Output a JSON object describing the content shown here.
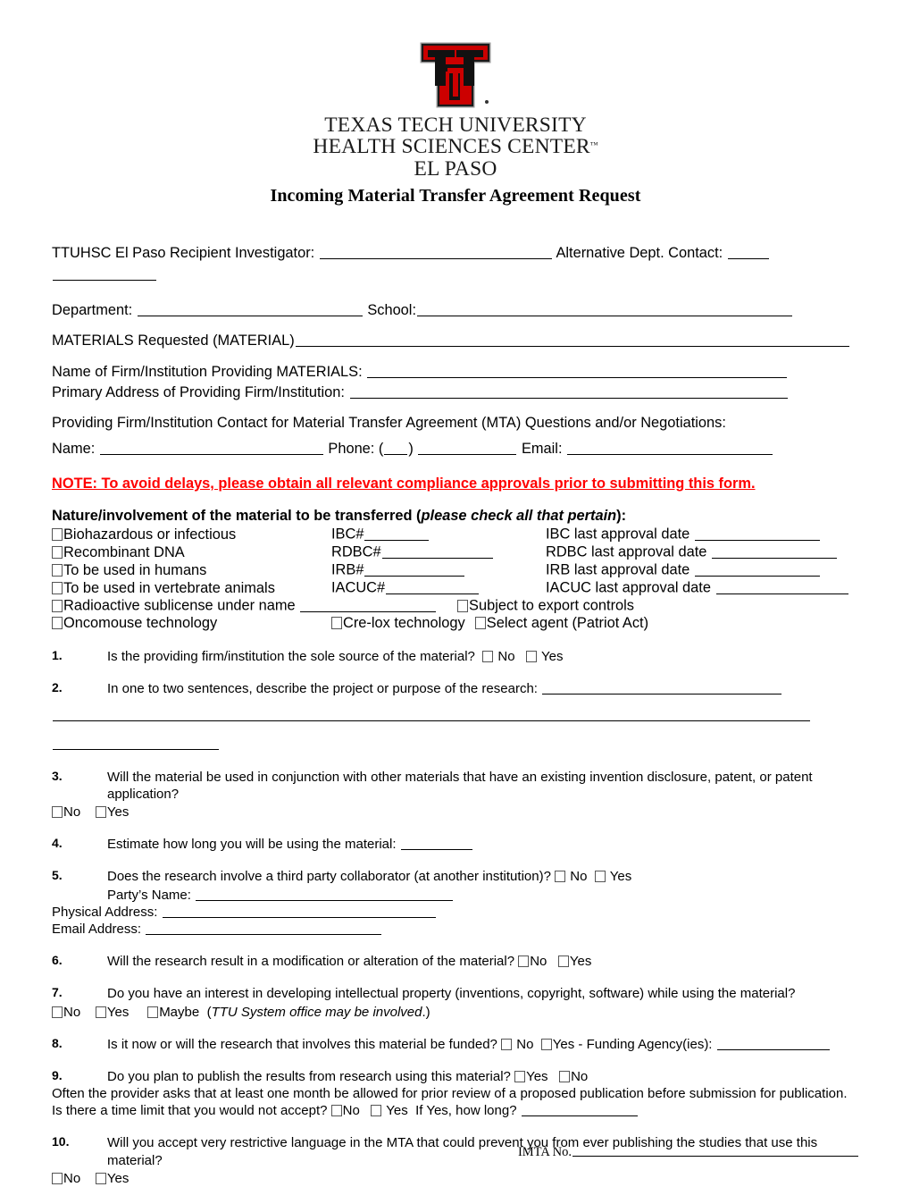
{
  "header": {
    "logo_name": "texas-tech-double-t-logo",
    "logo_colors": {
      "red": "#CC0000",
      "black": "#000000",
      "outline": "#888888"
    },
    "org_line1": "TEXAS TECH UNIVERSITY",
    "org_line2": "HEALTH SCIENCES CENTER",
    "org_trademark": "™",
    "org_line3": "EL PASO",
    "doc_title": "Incoming Material Transfer Agreement Request"
  },
  "fields": {
    "recipient_investigator_label": "TTUHSC El Paso Recipient Investigator:",
    "alt_dept_contact_label": "Alternative Dept. Contact:",
    "department_label": "Department:",
    "school_label": "School:",
    "materials_requested_label": "MATERIALS Requested (MATERIAL)",
    "firm_name_label": "Name of Firm/Institution Providing MATERIALS:",
    "firm_address_label": "Primary Address of Providing Firm/Institution:",
    "contact_intro": "Providing Firm/Institution Contact for Material Transfer Agreement (MTA) Questions and/or Negotiations:",
    "name_label": "Name:",
    "phone_label": "Phone: (",
    "phone_label_close": ")",
    "email_label": "Email:"
  },
  "note": "NOTE: To avoid delays, please obtain all relevant compliance approvals prior to submitting this form.",
  "nature": {
    "heading_pre": "Nature/involvement of the material to be transferred (",
    "heading_em": "please check all that pertain",
    "heading_post": "):",
    "rows": [
      {
        "label": "Biohazardous or infectious",
        "code": "IBC#",
        "approval": "IBC last approval date"
      },
      {
        "label": "Recombinant DNA",
        "code": "RDBC#",
        "approval": "RDBC last approval date"
      },
      {
        "label": "To be used in humans",
        "code": "IRB#",
        "approval": "IRB last approval date"
      },
      {
        "label": "To be used in vertebrate animals",
        "code": "IACUC#",
        "approval": "IACUC last approval date"
      }
    ],
    "radioactive_label": "Radioactive sublicense under name",
    "export_label": "Subject to export controls",
    "oncomouse_label": "Oncomouse technology",
    "crelox_label": "Cre-lox technology",
    "select_agent_label": "Select agent (Patriot Act)"
  },
  "questions": [
    {
      "num": "1.",
      "text": "Is the providing firm/institution the sole source of the material?",
      "opt_no": "No",
      "opt_yes": "Yes"
    },
    {
      "num": "2.",
      "text": "In one to two sentences, describe the project or purpose of the research:"
    },
    {
      "num": "3.",
      "text": "Will the material be used in conjunction with other materials that have an existing invention disclosure, patent, or patent application?",
      "opt_no": "No",
      "opt_yes": "Yes"
    },
    {
      "num": "4.",
      "text": "Estimate how long you will be using the material:"
    },
    {
      "num": "5.",
      "text": "Does the research involve a third party collaborator (at another institution)?",
      "opt_no": "No",
      "opt_yes": "Yes",
      "party_name_label": "Party’s Name:",
      "physical_address_label": "Physical Address:",
      "email_address_label": "Email Address:"
    },
    {
      "num": "6.",
      "text": "Will the research result in a modification or alteration of the material?",
      "opt_no": "No",
      "opt_yes": "Yes"
    },
    {
      "num": "7.",
      "text": "Do you have an interest in developing intellectual property (inventions, copyright, software) while using the material?",
      "opt_no": "No",
      "opt_yes": "Yes",
      "opt_maybe": "Maybe",
      "note_em": "TTU System office may be involved",
      "note_tail": ".)",
      "note_open": "("
    },
    {
      "num": "8.",
      "text": "Is it now or will the research that involves this material be funded?",
      "opt_no": "No",
      "opt_yes_funding": "Yes - Funding Agency(ies):"
    },
    {
      "num": "9.",
      "text": "Do you plan to publish the results from research using this material?",
      "opt_yes": "Yes",
      "opt_no": "No",
      "text2": "Often the provider asks that at least one month be allowed for prior review of a proposed publication before submission for publication. Is there a time limit that you would not accept?",
      "opt2_no": "No",
      "opt2_yes": "Yes",
      "howlong_label": "If Yes, how long?"
    },
    {
      "num": "10.",
      "text": "Will you accept very restrictive language in the MTA that could prevent you from ever publishing the studies that use this material?",
      "opt_no": "No",
      "opt_yes": "Yes"
    }
  ],
  "footer": {
    "imta_label": "IMTA No."
  }
}
